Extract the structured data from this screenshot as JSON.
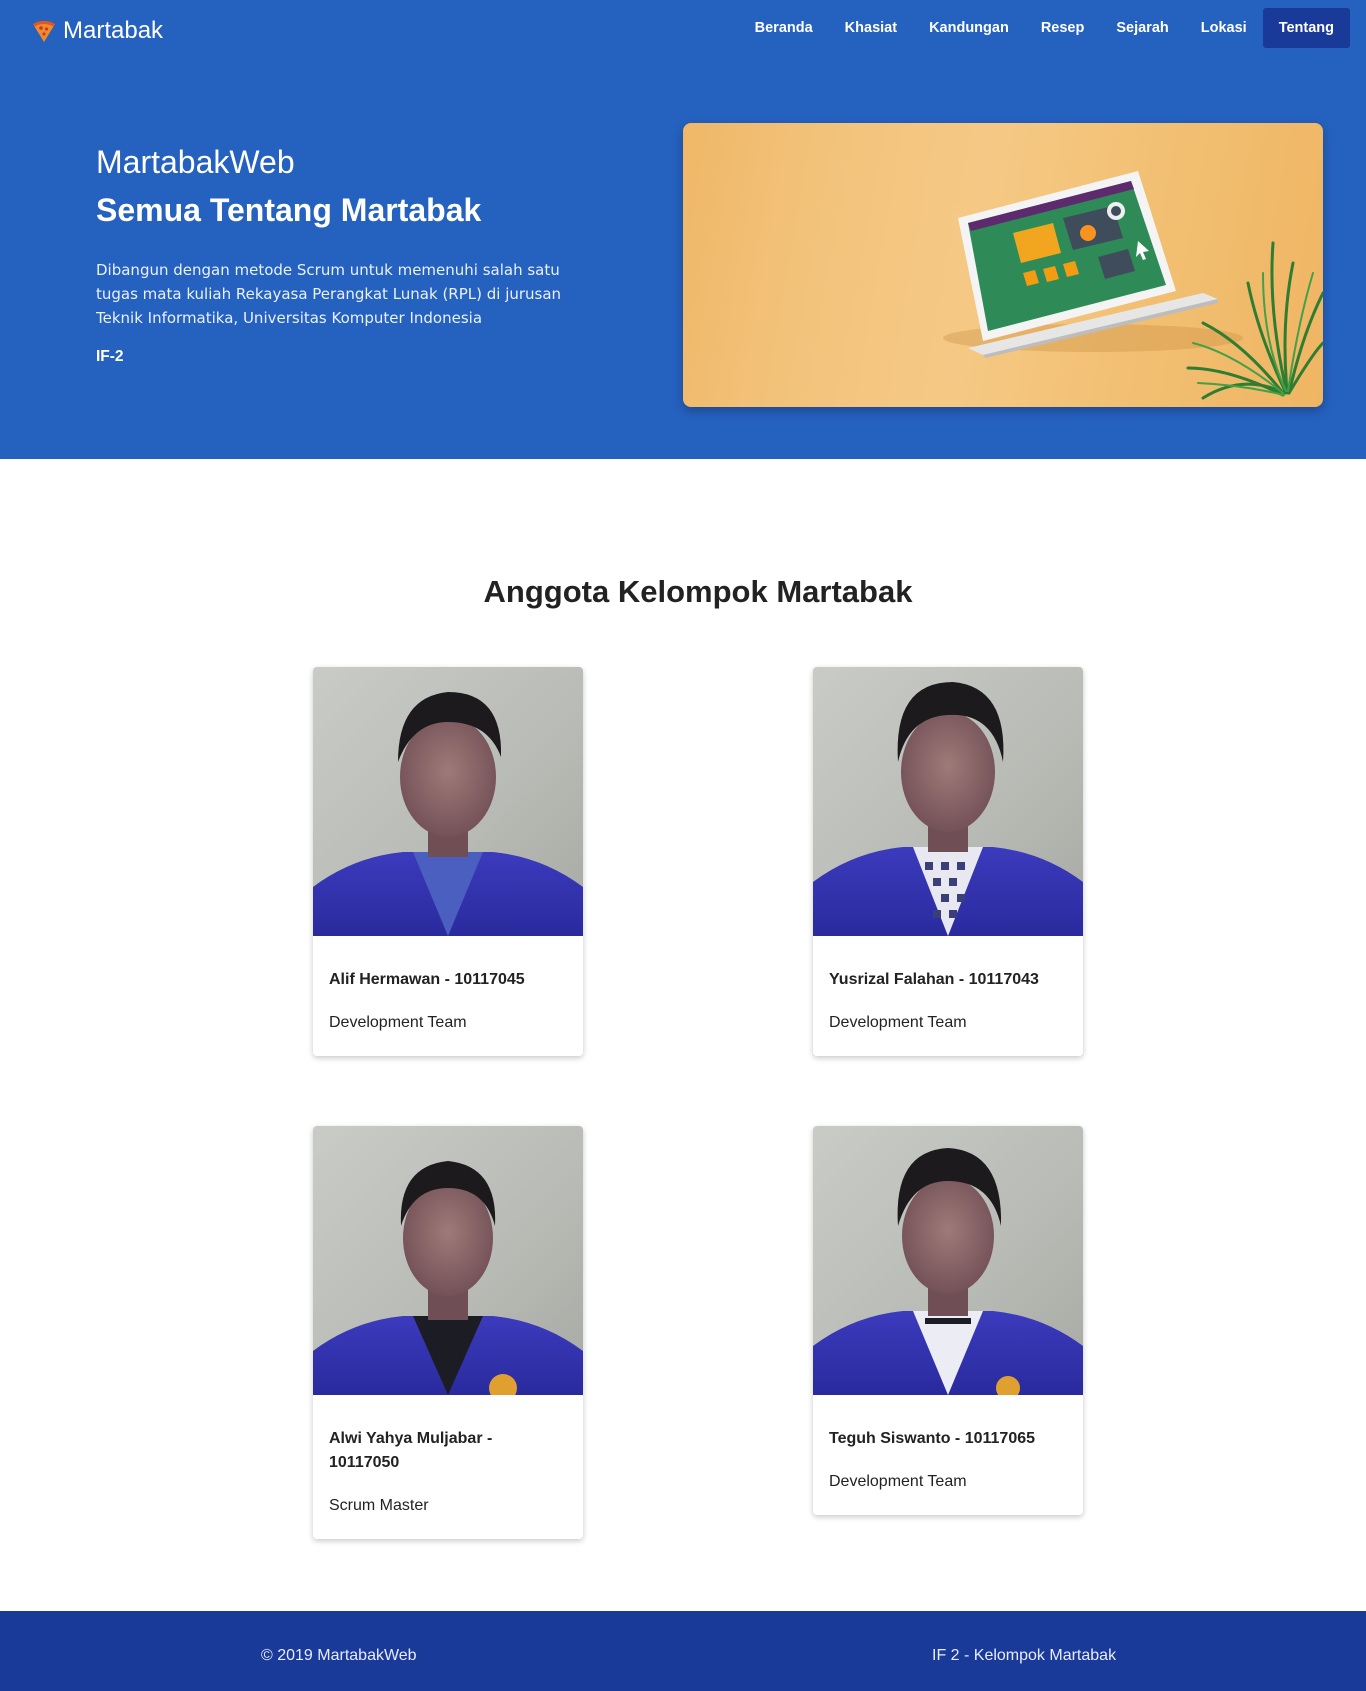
{
  "brand": {
    "name": "Martabak",
    "icon": "pizza-slice-icon"
  },
  "nav": {
    "items": [
      {
        "label": "Beranda"
      },
      {
        "label": "Khasiat"
      },
      {
        "label": "Kandungan"
      },
      {
        "label": "Resep"
      },
      {
        "label": "Sejarah"
      },
      {
        "label": "Lokasi"
      },
      {
        "label": "Tentang",
        "active": true
      }
    ]
  },
  "hero": {
    "title": "MartabakWeb",
    "subtitle": "Semua Tentang Martabak",
    "description": "Dibangun dengan metode Scrum untuk memenuhi salah satu tugas mata kuliah Rekayasa Perangkat Lunak (RPL) di jurusan Teknik Informatika, Universitas Komputer Indonesia",
    "tag": "IF-2",
    "image": "laptop-on-desk-illustration"
  },
  "team": {
    "title": "Anggota Kelompok Martabak",
    "members": [
      {
        "name": "Alif Hermawan - 10117045",
        "role": "Development Team",
        "photo": "member-photo"
      },
      {
        "name": "Yusrizal Falahan - 10117043",
        "role": "Development Team",
        "photo": "member-photo"
      },
      {
        "name": "Alwi Yahya Muljabar - 10117050",
        "role": "Scrum Master",
        "photo": "member-photo"
      },
      {
        "name": "Teguh Siswanto - 10117065",
        "role": "Development Team",
        "photo": "member-photo"
      }
    ]
  },
  "footer": {
    "left": "© 2019 MartabakWeb",
    "right": "IF 2 - Kelompok Martabak"
  },
  "colors": {
    "primary": "#2561bf",
    "primary_dark": "#1a3a99",
    "jacket": "#3a3ab8"
  }
}
